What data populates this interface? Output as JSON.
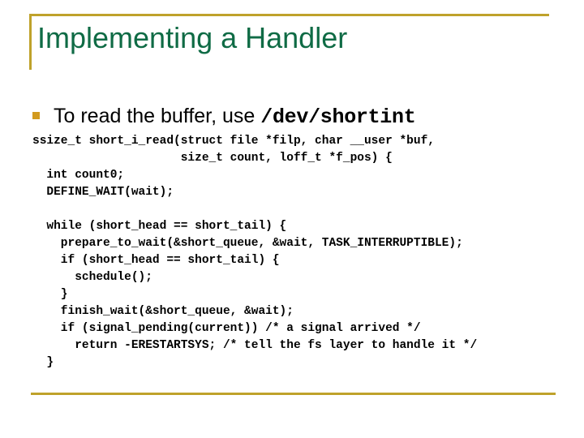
{
  "slide": {
    "title": "Implementing a Handler",
    "accent_gold": "#bfa22b",
    "bullet_gold": "#d29a1e",
    "title_green": "#0f6b45",
    "background": "#ffffff"
  },
  "bullet": {
    "marker": "square-bullet-icon",
    "text_plain": "To read the buffer, use ",
    "text_mono": "/dev/shortint"
  },
  "code": {
    "lines": [
      "ssize_t short_i_read(struct file *filp, char __user *buf,",
      "                     size_t count, loff_t *f_pos) {",
      "  int count0;",
      "  DEFINE_WAIT(wait);",
      "",
      "  while (short_head == short_tail) {",
      "    prepare_to_wait(&short_queue, &wait, TASK_INTERRUPTIBLE);",
      "    if (short_head == short_tail) {",
      "      schedule();",
      "    }",
      "    finish_wait(&short_queue, &wait);",
      "    if (signal_pending(current)) /* a signal arrived */",
      "      return -ERESTARTSYS; /* tell the fs layer to handle it */",
      "  }"
    ]
  }
}
